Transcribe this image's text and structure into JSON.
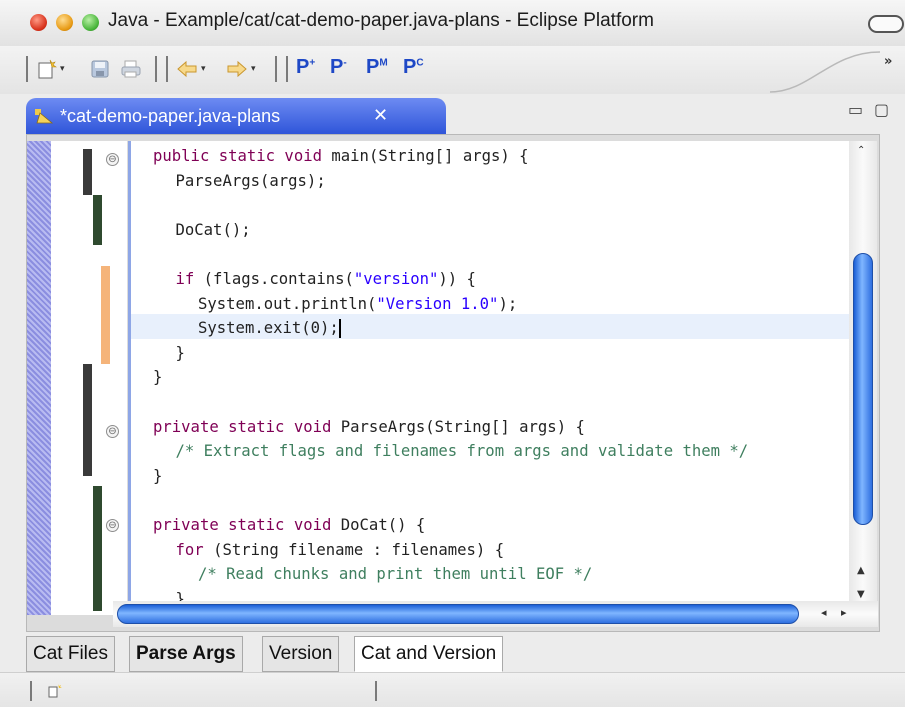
{
  "window": {
    "title": "Java - Example/cat/cat-demo-paper.java-plans - Eclipse Platform"
  },
  "toolbar": {
    "buttons": [
      {
        "icon": "new-wizard-icon"
      },
      {
        "icon": "save-icon"
      },
      {
        "icon": "print-icon"
      },
      {
        "icon": "back-arrow-icon"
      },
      {
        "icon": "forward-arrow-icon"
      }
    ],
    "plan_buttons": [
      {
        "label": "P",
        "sup": "+"
      },
      {
        "label": "P",
        "sup": "-"
      },
      {
        "label": "P",
        "sup": "M"
      },
      {
        "label": "P",
        "sup": "C"
      }
    ],
    "overflow": "»"
  },
  "editor_tab": {
    "title": "*cat-demo-paper.java-plans",
    "close": "✕",
    "icon": "java-plan-file-icon",
    "minimize": "▭",
    "maximize": "▢"
  },
  "code": {
    "lines": [
      {
        "indent": 0,
        "parts": [
          [
            "kw",
            "public static void "
          ],
          [
            "t",
            "main(String[] args) {"
          ]
        ]
      },
      {
        "indent": 1,
        "parts": [
          [
            "t",
            "ParseArgs(args);"
          ]
        ]
      },
      {
        "indent": 0,
        "parts": []
      },
      {
        "indent": 1,
        "parts": [
          [
            "t",
            "DoCat();"
          ]
        ]
      },
      {
        "indent": 0,
        "parts": []
      },
      {
        "indent": 1,
        "parts": [
          [
            "kw",
            "if "
          ],
          [
            "t",
            "(flags.contains("
          ],
          [
            "str",
            "\"version\""
          ],
          [
            "t",
            ")) {"
          ]
        ]
      },
      {
        "indent": 2,
        "parts": [
          [
            "t",
            "System.out.println("
          ],
          [
            "str",
            "\"Version 1.0\""
          ],
          [
            "t",
            ");"
          ]
        ]
      },
      {
        "indent": 2,
        "parts": [
          [
            "t",
            "System.exit(0);"
          ]
        ],
        "caret": true
      },
      {
        "indent": 1,
        "parts": [
          [
            "t",
            "}"
          ]
        ]
      },
      {
        "indent": 0,
        "parts": [
          [
            "t",
            "}"
          ]
        ]
      },
      {
        "indent": 0,
        "parts": []
      },
      {
        "indent": 0,
        "parts": [
          [
            "kw",
            "private static void "
          ],
          [
            "t",
            "ParseArgs(String[] args) {"
          ]
        ]
      },
      {
        "indent": 1,
        "parts": [
          [
            "cmt",
            "/* Extract flags and filenames from args and validate them */"
          ]
        ]
      },
      {
        "indent": 0,
        "parts": [
          [
            "t",
            "}"
          ]
        ]
      },
      {
        "indent": 0,
        "parts": []
      },
      {
        "indent": 0,
        "parts": [
          [
            "kw",
            "private static void "
          ],
          [
            "t",
            "DoCat() {"
          ]
        ]
      },
      {
        "indent": 1,
        "parts": [
          [
            "kw",
            "for "
          ],
          [
            "t",
            "(String filename : filenames) {"
          ]
        ]
      },
      {
        "indent": 2,
        "parts": [
          [
            "cmt",
            "/* Read chunks and print them until EOF */"
          ]
        ]
      },
      {
        "indent": 1,
        "parts": [
          [
            "t",
            "}"
          ]
        ]
      }
    ],
    "fold_markers": [
      "⊖",
      "⊖",
      "⊖"
    ]
  },
  "bottom_tabs": [
    {
      "label": "Cat Files",
      "bold": false,
      "active": false
    },
    {
      "label": "Parse Args",
      "bold": true,
      "active": false
    },
    {
      "label": "Version",
      "bold": false,
      "active": false
    },
    {
      "label": "Cat and Version",
      "bold": false,
      "active": true
    }
  ],
  "colors": {
    "keyword": "#7f0055",
    "string": "#2a00ff",
    "comment": "#3f7f5f",
    "plan_green": "#2f4a2f",
    "plan_dark": "#3a3a3a",
    "plan_orange": "#f5b47a",
    "tab_blue": "#2f55d9"
  }
}
